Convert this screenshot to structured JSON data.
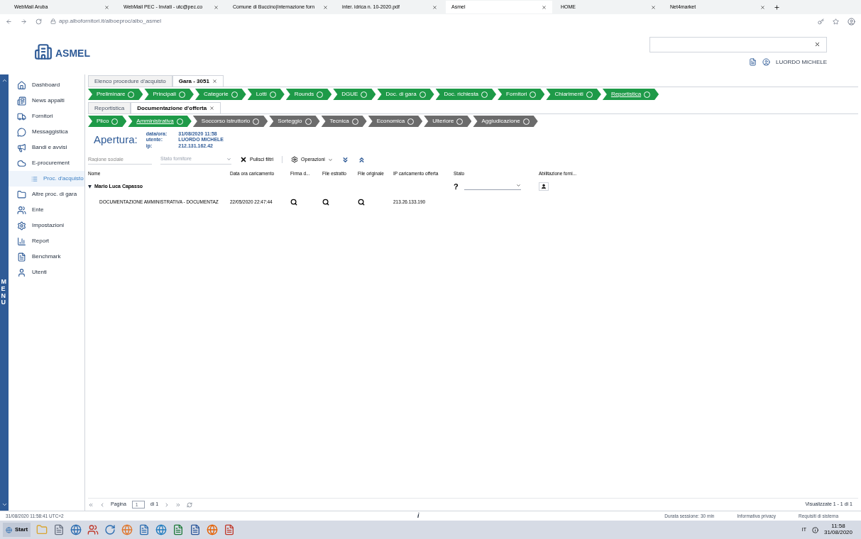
{
  "browser": {
    "tabs": [
      {
        "label": "WebMail Aruba",
        "selected": false
      },
      {
        "label": "WebMail PEC - Inviati - utc@pec.co",
        "selected": false
      },
      {
        "label": "Comune di Buccino|Internazione forn",
        "selected": false
      },
      {
        "label": "inter. idrica n. 10-2020.pdf",
        "selected": false
      },
      {
        "label": "Asmel",
        "selected": true
      },
      {
        "label": "HOME",
        "selected": false
      },
      {
        "label": "Net4market",
        "selected": false
      }
    ],
    "url": "app.albofornitori.it/alboeproc/albo_asmel"
  },
  "header": {
    "logo": "ASMEL",
    "user": "LUORDO MICHELE"
  },
  "sidebar": {
    "menu_label": "MENU",
    "items": [
      {
        "label": "Dashboard",
        "selected": false
      },
      {
        "label": "News appalti",
        "selected": false
      },
      {
        "label": "Fornitori",
        "selected": false
      },
      {
        "label": "Messaggistica",
        "selected": false
      },
      {
        "label": "Bandi e avvisi",
        "selected": false
      },
      {
        "label": "E-procurement",
        "selected": false,
        "children": [
          {
            "label": "Proc. d'acquisto",
            "selected": true
          }
        ]
      },
      {
        "label": "Altre proc. di gara",
        "selected": false
      },
      {
        "label": "Ente",
        "selected": false
      },
      {
        "label": "Impostazioni",
        "selected": false
      },
      {
        "label": "Report",
        "selected": false
      },
      {
        "label": "Benchmark",
        "selected": false
      },
      {
        "label": "Utenti",
        "selected": false
      }
    ]
  },
  "page_tabs": [
    {
      "label": "Elenco procedure d'acquisto",
      "selected": false,
      "closable": false
    },
    {
      "label": "Gara - 3051",
      "selected": true,
      "closable": true
    }
  ],
  "steps": [
    {
      "label": "Preliminare",
      "enabled": true,
      "selected": false
    },
    {
      "label": "Principali",
      "enabled": true,
      "selected": false
    },
    {
      "label": "Categorie",
      "enabled": true,
      "selected": false
    },
    {
      "label": "Lotti",
      "enabled": true,
      "selected": false
    },
    {
      "label": "Rounds",
      "enabled": true,
      "selected": false
    },
    {
      "label": "DGUE",
      "enabled": true,
      "selected": false
    },
    {
      "label": "Doc. di gara",
      "enabled": true,
      "selected": false
    },
    {
      "label": "Doc. richiesta",
      "enabled": true,
      "selected": false
    },
    {
      "label": "Fornitori",
      "enabled": true,
      "selected": false
    },
    {
      "label": "Chiarimenti",
      "enabled": true,
      "selected": false
    },
    {
      "label": "Reportistica",
      "enabled": true,
      "selected": true
    }
  ],
  "sub_tabs": [
    {
      "label": "Reportistica",
      "selected": false,
      "closable": false
    },
    {
      "label": "Documentazione d'offerta",
      "selected": true,
      "closable": true
    }
  ],
  "sub_steps": [
    {
      "label": "Plico",
      "enabled": true,
      "selected": false
    },
    {
      "label": "Amministrativa",
      "enabled": true,
      "selected": true
    },
    {
      "label": "Soccorso istruttorio",
      "enabled": false,
      "selected": false
    },
    {
      "label": "Sorteggio",
      "enabled": false,
      "selected": false
    },
    {
      "label": "Tecnica",
      "enabled": false,
      "selected": false
    },
    {
      "label": "Economica",
      "enabled": false,
      "selected": false
    },
    {
      "label": "Ulteriore",
      "enabled": false,
      "selected": false
    },
    {
      "label": "Aggiudicazione",
      "enabled": false,
      "selected": false
    }
  ],
  "opening": {
    "title": "Apertura:",
    "fields": [
      {
        "label": "data/ora:",
        "value": "31/08/2020 11:58"
      },
      {
        "label": "utente:",
        "value": "LUORDO MICHELE"
      },
      {
        "label": "ip:",
        "value": "212.131.162.42"
      }
    ]
  },
  "filters": {
    "name_placeholder": "Ragione sociale",
    "status_placeholder": "Stato fornitore",
    "clear": "Pulisci filtri",
    "operations": "Operazioni"
  },
  "table": {
    "columns": [
      "Nome",
      "Data ora caricamento",
      "Firma d...",
      "File estratto",
      "File originale",
      "IP caricamento offerta",
      "Stato",
      "Abilitazione forni..."
    ],
    "groups": [
      {
        "name": "Mario Luca Capasso",
        "expanded": true,
        "status": "?",
        "rows": [
          {
            "name": "DOCUMENTAZIONE AMMINISTRATIVA - DOCUMENTAZ",
            "date": "22/05/2020 22:47:44",
            "ip": "213.26.133.190"
          }
        ]
      }
    ]
  },
  "pager": {
    "page_label": "Pagina",
    "page": "1",
    "of": "di 1",
    "summary": "Visualizzate 1 - 1 di 1"
  },
  "status_bar": {
    "time": "31/08/2020 11:58:41 UTC+2",
    "info": "i",
    "session": "Durata sessione: 30 min",
    "privacy": "Informativa privacy",
    "requirements": "Requisiti di sistema"
  },
  "taskbar": {
    "start": "Start",
    "lang": "IT",
    "clock": "11:58",
    "date": "31/08/2020"
  }
}
